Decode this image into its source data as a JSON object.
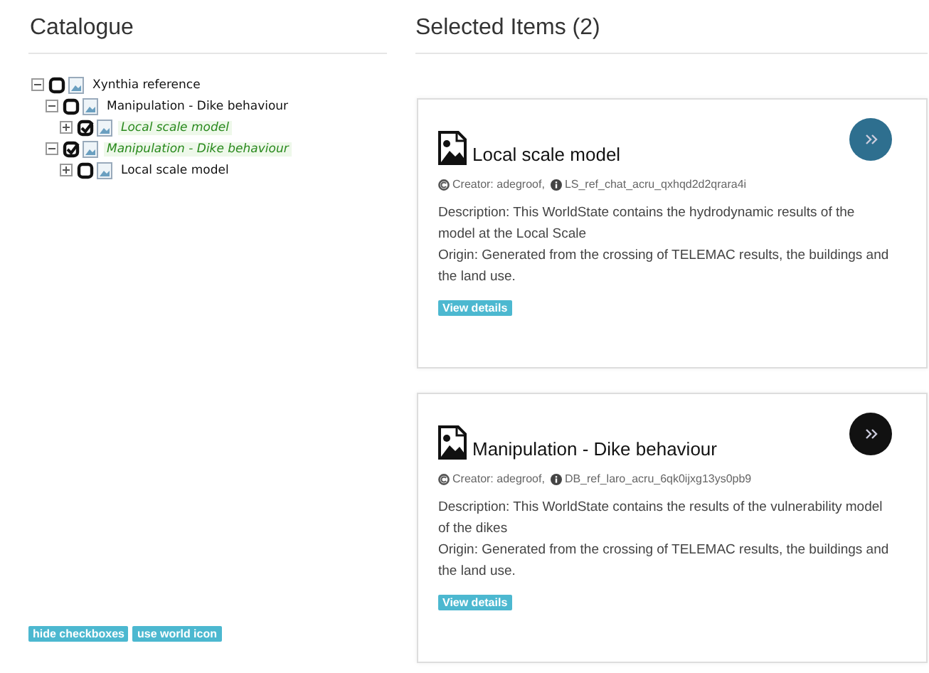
{
  "catalogue": {
    "title": "Catalogue",
    "tree": [
      {
        "label": "Xynthia reference",
        "expanded": true,
        "checked": false,
        "selected": false,
        "children": [
          {
            "label": "Manipulation - Dike behaviour",
            "expanded": true,
            "checked": false,
            "selected": false,
            "children": [
              {
                "label": "Local scale model",
                "expanded": false,
                "checked": true,
                "selected": true
              }
            ]
          },
          {
            "label": "Manipulation - Dike behaviour",
            "expanded": true,
            "checked": true,
            "selected": true,
            "children": [
              {
                "label": "Local scale model",
                "expanded": false,
                "checked": false,
                "selected": false
              }
            ]
          }
        ]
      }
    ],
    "buttons": [
      "hide checkboxes",
      "use world icon"
    ]
  },
  "selected_items": {
    "title": "Selected Items (2)",
    "items": [
      {
        "title": "Local scale model",
        "creator": "Creator: adegroof,",
        "id": "LS_ref_chat_acru_qxhqd2d2qrara4i",
        "description": "Description: This WorldState contains the hydrodynamic results of the model at the Local Scale",
        "origin": "Origin: Generated from the crossing of TELEMAC results, the buildings and the land use.",
        "details_button": "View details",
        "color": "#2e6f8f"
      },
      {
        "title": "Manipulation - Dike behaviour",
        "creator": "Creator: adegroof,",
        "id": "DB_ref_laro_acru_6qk0ijxg13ys0pb9",
        "description": "Description: This WorldState contains the results of the vulnerability model of the dikes",
        "origin": "Origin: Generated from the crossing of TELEMAC results, the buildings and the land use.",
        "details_button": "View details",
        "color": "#111111"
      }
    ]
  }
}
